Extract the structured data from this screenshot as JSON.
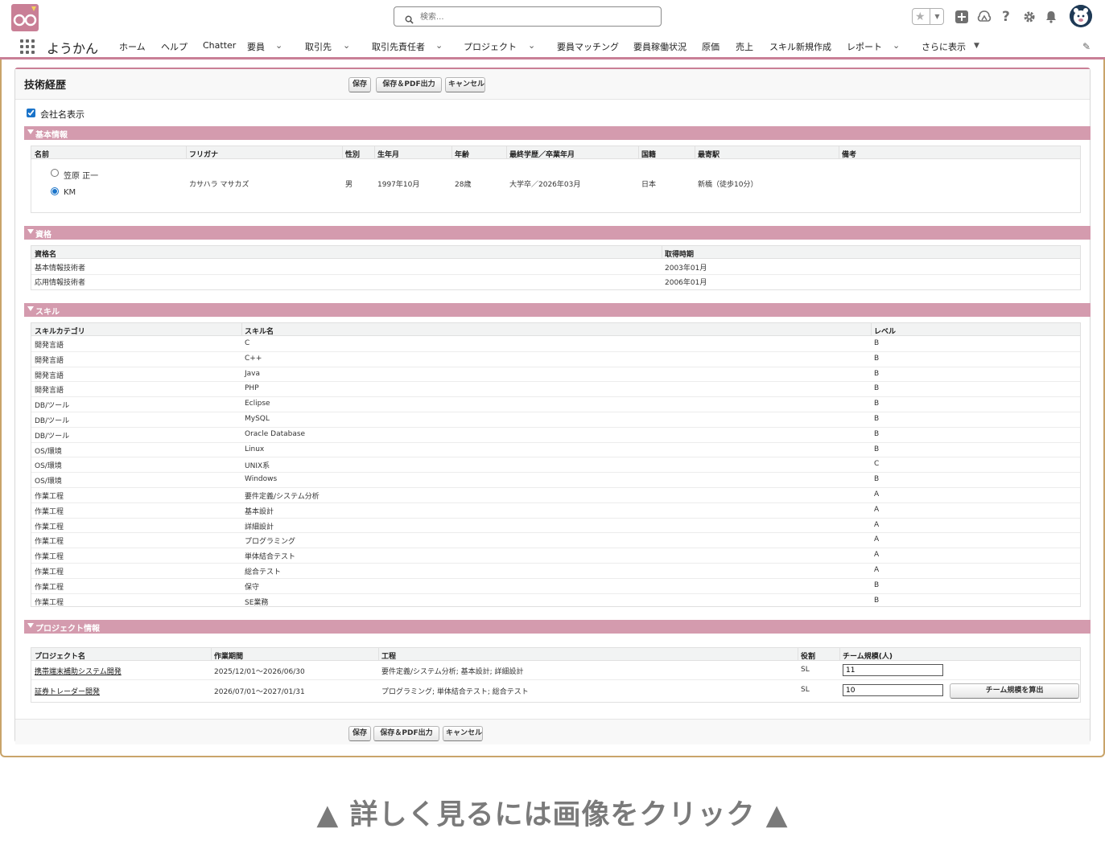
{
  "header": {
    "search_placeholder": "検索...",
    "icons": [
      "favorites-star-icon",
      "global-add-icon",
      "trailhead-icon",
      "help-icon",
      "setup-gear-icon",
      "notification-bell-icon",
      "user-avatar-icon"
    ]
  },
  "nav": {
    "app_name": "ようかん",
    "items": [
      "ホーム",
      "ヘルプ",
      "Chatter",
      "要員",
      "取引先",
      "取引先責任者",
      "プロジェクト",
      "要員マッチング",
      "要員稼働状況",
      "原価",
      "売上",
      "スキル新規作成",
      "レポート",
      "さらに表示"
    ]
  },
  "page": {
    "title": "技術経歴",
    "buttons": {
      "save": "保存",
      "save_pdf": "保存＆PDF出力",
      "cancel": "キャンセル"
    },
    "show_company_label": "会社名表示",
    "show_company_checked": true
  },
  "basic": {
    "section_title": "基本情報",
    "headers": [
      "名前",
      "フリガナ",
      "性別",
      "生年月",
      "年齢",
      "最終学歴／卒業年月",
      "国籍",
      "最寄駅",
      "備考"
    ],
    "name_options": [
      "笠原 正一",
      "KM"
    ],
    "selected_name": "KM",
    "furigana": "カサハラ マサカズ",
    "gender": "男",
    "birth": "1997年10月",
    "age": "28歳",
    "education": "大学卒／2026年03月",
    "nationality": "日本",
    "station": "新橋（徒歩10分）",
    "note": ""
  },
  "qualifications": {
    "section_title": "資格",
    "headers": [
      "資格名",
      "取得時期"
    ],
    "rows": [
      [
        "基本情報技術者",
        "2003年01月"
      ],
      [
        "応用情報技術者",
        "2006年01月"
      ]
    ]
  },
  "skills": {
    "section_title": "スキル",
    "headers": [
      "スキルカテゴリ",
      "スキル名",
      "レベル"
    ],
    "rows": [
      [
        "開発言語",
        "C",
        "B"
      ],
      [
        "開発言語",
        "C++",
        "B"
      ],
      [
        "開発言語",
        "Java",
        "B"
      ],
      [
        "開発言語",
        "PHP",
        "B"
      ],
      [
        "DB/ツール",
        "Eclipse",
        "B"
      ],
      [
        "DB/ツール",
        "MySQL",
        "B"
      ],
      [
        "DB/ツール",
        "Oracle Database",
        "B"
      ],
      [
        "OS/環境",
        "Linux",
        "B"
      ],
      [
        "OS/環境",
        "UNIX系",
        "C"
      ],
      [
        "OS/環境",
        "Windows",
        "B"
      ],
      [
        "作業工程",
        "要件定義/システム分析",
        "A"
      ],
      [
        "作業工程",
        "基本設計",
        "A"
      ],
      [
        "作業工程",
        "詳細設計",
        "A"
      ],
      [
        "作業工程",
        "プログラミング",
        "A"
      ],
      [
        "作業工程",
        "単体結合テスト",
        "A"
      ],
      [
        "作業工程",
        "総合テスト",
        "A"
      ],
      [
        "作業工程",
        "保守",
        "B"
      ],
      [
        "作業工程",
        "SE業務",
        "B"
      ]
    ]
  },
  "projects": {
    "section_title": "プロジェクト情報",
    "headers": [
      "プロジェクト名",
      "作業期間",
      "工程",
      "役割",
      "チーム規模(人)"
    ],
    "rows": [
      {
        "name": "携帯端末補助システム開発",
        "period": "2025/12/01～2026/06/30",
        "process": "要件定義/システム分析; 基本設計; 詳細設計",
        "role": "SL",
        "team": "11"
      },
      {
        "name": "証券トレーダー開発",
        "period": "2026/07/01～2027/01/31",
        "process": "プログラミング; 単体結合テスト; 総合テスト",
        "role": "SL",
        "team": "10"
      }
    ],
    "calc_button": "チーム規模を算出"
  },
  "cta": "▲ 詳しく見るには画像をクリック ▲",
  "colors": {
    "accent": "#c97f96",
    "section": "#d49bae",
    "frame": "#c9a46a"
  }
}
